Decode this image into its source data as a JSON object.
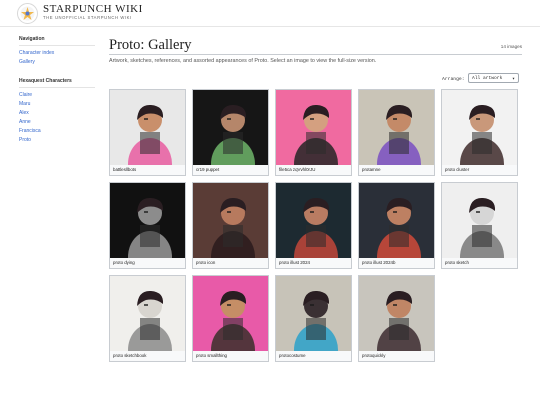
{
  "site": {
    "title": "STARPUNCH WIKI",
    "tagline": "THE UNOFFICIAL STARPUNCH WIKI"
  },
  "sidebar": {
    "nav_heading": "Navigation",
    "nav_items": [
      {
        "label": "Character index"
      },
      {
        "label": "Gallery"
      }
    ],
    "chars_heading": "Hexaquest Characters",
    "chars_items": [
      {
        "label": "Claire"
      },
      {
        "label": "Maru"
      },
      {
        "label": "Alex"
      },
      {
        "label": "Anne"
      },
      {
        "label": "Francisca"
      },
      {
        "label": "Proto"
      }
    ]
  },
  "page": {
    "title": "Proto: Gallery",
    "count": "14 images",
    "description": "Artwork, sketches, references, and assorted appearances of Proto. Select an image to view the full-size version.",
    "arrange_label": "Arrange:",
    "arrange_value": "All artwork"
  },
  "gallery": [
    {
      "caption": "battlesllbots",
      "bg": "#e8e8e8",
      "accent": "#e85ca0",
      "skin": "#c98f6b"
    },
    {
      "caption": "cr19 puppet",
      "bg": "#161616",
      "accent": "#6fb56a",
      "skin": "#b5866a"
    },
    {
      "caption": "file5ca zqVvhl0rJU",
      "bg": "#f06aa0",
      "accent": "#242424",
      "skin": "#d4a080"
    },
    {
      "caption": "protamne",
      "bg": "#c9c4b7",
      "accent": "#7a4fc2",
      "skin": "#c48a68"
    },
    {
      "caption": "proto cluster",
      "bg": "#f2f2f2",
      "accent": "#3e2a2a",
      "skin": "#c9987a"
    },
    {
      "caption": "proto dying",
      "bg": "#111111",
      "accent": "#9a9a9a",
      "skin": "#8c8c8c"
    },
    {
      "caption": "proto icon",
      "bg": "#5a3c36",
      "accent": "#2a1a1c",
      "skin": "#b77a5e"
    },
    {
      "caption": "proto illust 2024",
      "bg": "#1d2a31",
      "accent": "#c2463a",
      "skin": "#b97c62"
    },
    {
      "caption": "proto illust 2024b",
      "bg": "#2a2f38",
      "accent": "#d04a3a",
      "skin": "#bd8062"
    },
    {
      "caption": "proto sketch",
      "bg": "#efefef",
      "accent": "#777777",
      "skin": "#d6d6d6"
    },
    {
      "caption": "proto sketchbook",
      "bg": "#f0efec",
      "accent": "#8b8b8b",
      "skin": "#d8d5cf"
    },
    {
      "caption": "proto smallthing",
      "bg": "#e85aa8",
      "accent": "#3a2f2a",
      "skin": "#c58e66"
    },
    {
      "caption": "protocostume",
      "bg": "#c7c3b8",
      "accent": "#2aa1c9",
      "skin": "#3a3033"
    },
    {
      "caption": "protoquickly",
      "bg": "#c8c5bd",
      "accent": "#3c2a30",
      "skin": "#c08666"
    }
  ]
}
